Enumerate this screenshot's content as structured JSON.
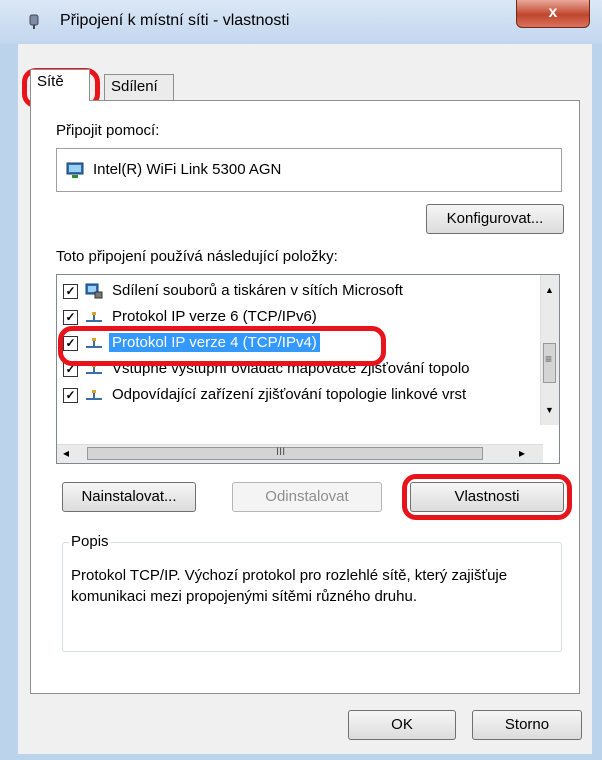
{
  "window": {
    "title": "Připojení k místní síti - vlastnosti",
    "close_label": "x"
  },
  "tabs": [
    {
      "label": "Sítě"
    },
    {
      "label": "Sdílení"
    }
  ],
  "connect_using": {
    "label": "Připojit pomocí:",
    "adapter": "Intel(R) WiFi Link 5300 AGN",
    "configure_label": "Konfigurovat..."
  },
  "items_label": "Toto připojení používá následující položky:",
  "items": [
    {
      "label": "Sdílení souborů a tiskáren v sítích Microsoft",
      "checked": true,
      "icon": "network-client-icon"
    },
    {
      "label": "Protokol IP verze 6 (TCP/IPv6)",
      "checked": true,
      "icon": "protocol-icon"
    },
    {
      "label": "Protokol IP verze 4 (TCP/IPv4)",
      "checked": true,
      "icon": "protocol-icon",
      "selected": true
    },
    {
      "label": "Vstupně výstupní ovladač mapovače zjišťování topolo",
      "checked": true,
      "icon": "protocol-icon"
    },
    {
      "label": "Odpovídající zařízení zjišťování topologie linkové vrst",
      "checked": true,
      "icon": "protocol-icon"
    }
  ],
  "scroll": {
    "left": "◂",
    "right": "▸",
    "up": "▲",
    "down": "▼",
    "thumb": "III",
    "grip": "≡"
  },
  "buttons": {
    "install": "Nainstalovat...",
    "uninstall": "Odinstalovat",
    "properties": "Vlastnosti",
    "ok": "OK",
    "cancel": "Storno"
  },
  "description": {
    "legend": "Popis",
    "text": "Protokol TCP/IP. Výchozí protokol pro rozlehlé sítě, který zajišťuje komunikaci mezi propojenými sítěmi různého druhu."
  },
  "colors": {
    "highlight": "#e8141c",
    "selection": "#3399ff"
  }
}
